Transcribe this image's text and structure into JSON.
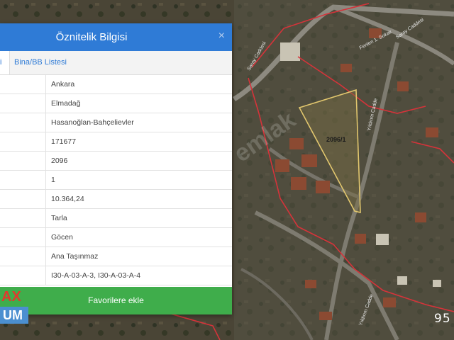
{
  "map": {
    "parcel_label": "2096/1",
    "streets": [
      "Saray Caddesi",
      "Saray Caddesi",
      "Fenlen 1. Sokak",
      "Yıldırım Cadde",
      "Yıldırım Cadde"
    ],
    "watermark": "emlak"
  },
  "panel": {
    "title": "Öznitelik Bilgisi",
    "close_label": "×",
    "tabs": [
      {
        "label": "isi"
      },
      {
        "label": "Bina/BB Listesi"
      }
    ],
    "rows": [
      {
        "value": "Ankara"
      },
      {
        "value": "Elmadağ"
      },
      {
        "value": "Hasanoğlan-Bahçelievler"
      },
      {
        "value": "171677"
      },
      {
        "value": "2096"
      },
      {
        "value": "1"
      },
      {
        "value": "10.364,24"
      },
      {
        "value": "Tarla"
      },
      {
        "value": "Göcen"
      },
      {
        "value": "Ana Taşınmaz"
      },
      {
        "value": "I30-A-03-A-3, I30-A-03-A-4"
      }
    ],
    "favorite_button": "Favorilere ekle"
  },
  "logo": {
    "top": "AX",
    "bottom": "UM"
  },
  "corner_number": "95"
}
